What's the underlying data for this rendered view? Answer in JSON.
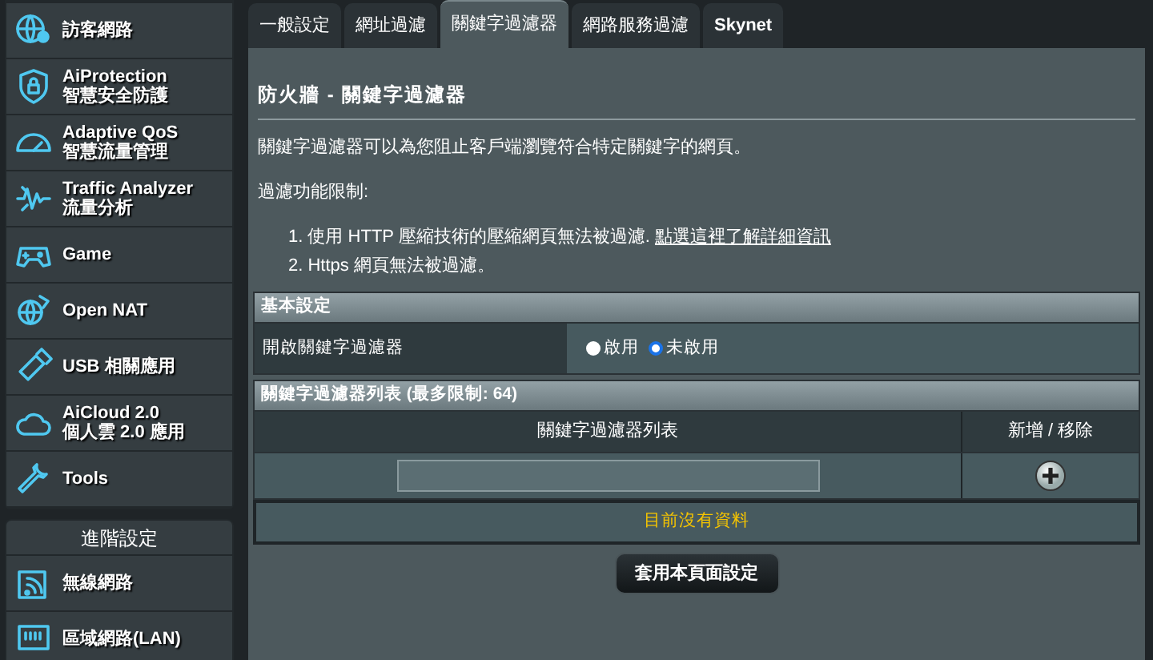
{
  "sidebar": {
    "items": [
      {
        "title": "訪客網路"
      },
      {
        "title": "AiProtection",
        "subtitle": "智慧安全防護"
      },
      {
        "title": "Adaptive QoS",
        "subtitle": "智慧流量管理"
      },
      {
        "title": "Traffic Analyzer",
        "subtitle": "流量分析"
      },
      {
        "title": "Game"
      },
      {
        "title": "Open NAT"
      },
      {
        "title": "USB 相關應用"
      },
      {
        "title": "AiCloud 2.0",
        "subtitle": "個人雲 2.0 應用"
      },
      {
        "title": "Tools"
      }
    ],
    "advanced_header": "進階設定",
    "advanced_items": [
      {
        "title": "無線網路"
      },
      {
        "title": "區域網路(LAN)"
      }
    ]
  },
  "tabs": [
    {
      "label": "一般設定",
      "selected": false
    },
    {
      "label": "網址過濾",
      "selected": false
    },
    {
      "label": "關鍵字過濾器",
      "selected": true
    },
    {
      "label": "網路服務過濾",
      "selected": false
    },
    {
      "label": "Skynet",
      "selected": false
    }
  ],
  "page_title": {
    "text": "防火牆 - 關鍵字過濾器"
  },
  "description": "關鍵字過濾器可以為您阻止客戶端瀏覽符合特定關鍵字的網頁。",
  "limits_heading": "過濾功能限制:",
  "limits": [
    {
      "text": "1. 使用 HTTP 壓縮技術的壓縮網頁無法被過濾.",
      "link": "點選這裡了解詳細資訊"
    },
    {
      "text": "2. Https 網頁無法被過濾。"
    }
  ],
  "basic_settings": {
    "header": "基本設定",
    "label": "開啟關鍵字過濾器",
    "options": [
      {
        "label": "啟用",
        "selected": false
      },
      {
        "label": "未啟用",
        "selected": true
      }
    ]
  },
  "keyword_table": {
    "header": "關鍵字過濾器列表 (最多限制: 64)",
    "columns": [
      "關鍵字過濾器列表",
      "新增 / 移除"
    ],
    "empty_message": "目前沒有資料"
  },
  "apply_button": "套用本頁面設定"
}
